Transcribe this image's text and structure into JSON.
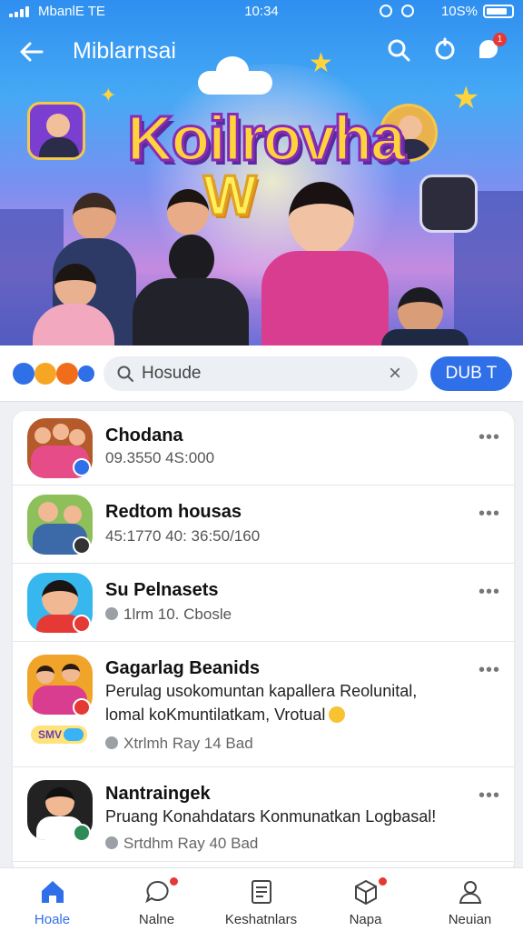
{
  "status_bar": {
    "carrier": "MbanlE TE",
    "time": "10:34",
    "battery": "10S%"
  },
  "header": {
    "title": "Miblarnsai",
    "notification_count": "1"
  },
  "hero": {
    "logo_text": "Koilrovha",
    "logo_sub": "W"
  },
  "search": {
    "query": "Hosude",
    "action_label": "DUB T"
  },
  "list": [
    {
      "name": "Chodana",
      "sub": "09.3550 4S:000",
      "badge_color": "#2f6fe8",
      "bg": "#b55a2a"
    },
    {
      "name": "Redtom housas",
      "sub": "45:1770 40: 36:50/160",
      "badge_color": "#333333",
      "bg": "#8dbf5a"
    },
    {
      "name": "Su Pelnasets",
      "sub": "1lrm 10. Cbosle",
      "badge_color": "#e53935",
      "bg": "#36b8ef"
    },
    {
      "name": "Gagarlag Beanids",
      "body_1": "Perulag usokomuntan kapallera Reolunital,",
      "body_2": "lomal koKmuntilatkam, Vrotual",
      "meta": "Xtrlmh Ray 14 Bad",
      "tag": "SMV",
      "badge_color": "#e53935",
      "bg": "#f0a52a"
    },
    {
      "name": "Nantraingek",
      "body_1": "Pruang Konahdatars Konmunatkan Logbasal!",
      "meta": "Srtdhm Ray 40 Bad",
      "badge_color": "#2e8b57",
      "bg": "#222222"
    }
  ],
  "bottom_nav": [
    {
      "label": "Hoale",
      "icon": "home-icon",
      "active": true
    },
    {
      "label": "Nalne",
      "icon": "chat-icon",
      "badge": true
    },
    {
      "label": "Keshatnlars",
      "icon": "document-icon"
    },
    {
      "label": "Napa",
      "icon": "box-icon",
      "badge": true
    },
    {
      "label": "Neuian",
      "icon": "profile-icon"
    }
  ],
  "colors": {
    "accent": "#2f6fe8",
    "badge": "#e53935"
  }
}
